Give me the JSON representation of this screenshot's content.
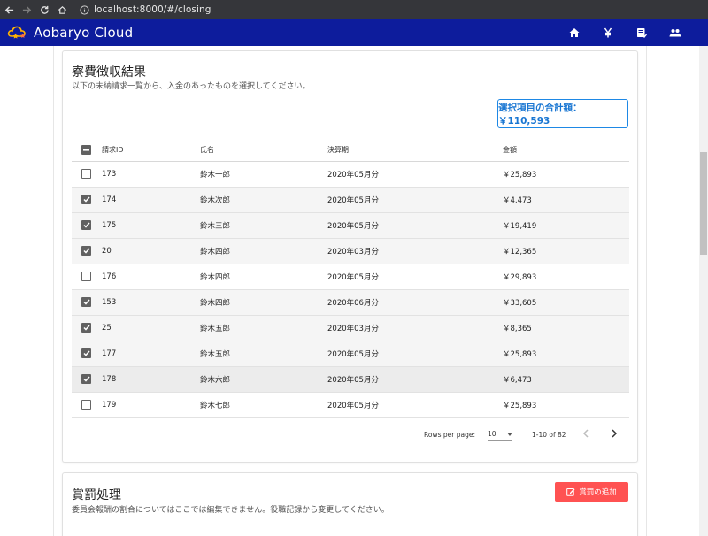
{
  "browser": {
    "url": "localhost:8000/#/closing"
  },
  "app": {
    "title": "Aobaryo Cloud",
    "actions": [
      {
        "icon": "home-icon"
      },
      {
        "icon": "yen-icon"
      },
      {
        "icon": "receipt-icon"
      },
      {
        "icon": "people-icon"
      }
    ]
  },
  "billing": {
    "title": "寮費徴収結果",
    "subtitle": "以下の未納請求一覧から、入金のあったものを選択してください。",
    "total_label": "選択項目の合計額：￥110,593",
    "headers": {
      "id": "請求ID",
      "name": "氏名",
      "period": "決算期",
      "amount": "金額"
    },
    "rows": [
      {
        "checked": false,
        "id": "173",
        "name": "鈴木一郎",
        "period": "2020年05月分",
        "amount": "￥25,893"
      },
      {
        "checked": true,
        "id": "174",
        "name": "鈴木次郎",
        "period": "2020年05月分",
        "amount": "￥4,473"
      },
      {
        "checked": true,
        "id": "175",
        "name": "鈴木三郎",
        "period": "2020年05月分",
        "amount": "￥19,419"
      },
      {
        "checked": true,
        "id": "20",
        "name": "鈴木四郎",
        "period": "2020年03月分",
        "amount": "￥12,365"
      },
      {
        "checked": false,
        "id": "176",
        "name": "鈴木四郎",
        "period": "2020年05月分",
        "amount": "￥29,893"
      },
      {
        "checked": true,
        "id": "153",
        "name": "鈴木四郎",
        "period": "2020年06月分",
        "amount": "￥33,605"
      },
      {
        "checked": true,
        "id": "25",
        "name": "鈴木五郎",
        "period": "2020年03月分",
        "amount": "￥8,365"
      },
      {
        "checked": true,
        "id": "177",
        "name": "鈴木五郎",
        "period": "2020年05月分",
        "amount": "￥25,893"
      },
      {
        "checked": true,
        "id": "178",
        "name": "鈴木六郎",
        "period": "2020年05月分",
        "amount": "￥6,473"
      },
      {
        "checked": false,
        "id": "179",
        "name": "鈴木七郎",
        "period": "2020年05月分",
        "amount": "￥25,893"
      }
    ],
    "footer": {
      "rows_per_page_label": "Rows per page:",
      "rows_per_page_value": "10",
      "range": "1-10 of 82"
    }
  },
  "rewards": {
    "title": "賞罰処理",
    "subtitle": "委員会報酬の割合についてはここでは編集できません。役職記録から変更してください。",
    "add_label": "賞罰の追加"
  },
  "colors": {
    "app_bar": "#0d1c9c",
    "accent": "#1976d2",
    "danger": "#ff5252"
  }
}
